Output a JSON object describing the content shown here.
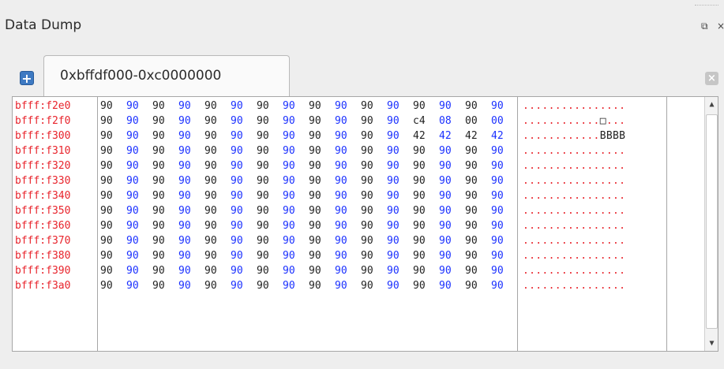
{
  "window": {
    "title": "Data Dump"
  },
  "tab": {
    "label": "0xbffdf000-0xc0000000"
  },
  "colors": {
    "address": "#e8232b",
    "byte_blue": "#1a30ff",
    "byte_black": "#222222",
    "ascii": "#e8232b"
  },
  "rows": [
    {
      "addr": "bfff:f2e0",
      "bytes": [
        "90",
        "90",
        "90",
        "90",
        "90",
        "90",
        "90",
        "90",
        "90",
        "90",
        "90",
        "90",
        "90",
        "90",
        "90",
        "90"
      ],
      "ascii": "................"
    },
    {
      "addr": "bfff:f2f0",
      "bytes": [
        "90",
        "90",
        "90",
        "90",
        "90",
        "90",
        "90",
        "90",
        "90",
        "90",
        "90",
        "90",
        "c4",
        "08",
        "00",
        "00"
      ],
      "ascii": "............□..."
    },
    {
      "addr": "bfff:f300",
      "bytes": [
        "90",
        "90",
        "90",
        "90",
        "90",
        "90",
        "90",
        "90",
        "90",
        "90",
        "90",
        "90",
        "42",
        "42",
        "42",
        "42"
      ],
      "ascii": "............BBBB"
    },
    {
      "addr": "bfff:f310",
      "bytes": [
        "90",
        "90",
        "90",
        "90",
        "90",
        "90",
        "90",
        "90",
        "90",
        "90",
        "90",
        "90",
        "90",
        "90",
        "90",
        "90"
      ],
      "ascii": "................"
    },
    {
      "addr": "bfff:f320",
      "bytes": [
        "90",
        "90",
        "90",
        "90",
        "90",
        "90",
        "90",
        "90",
        "90",
        "90",
        "90",
        "90",
        "90",
        "90",
        "90",
        "90"
      ],
      "ascii": "................"
    },
    {
      "addr": "bfff:f330",
      "bytes": [
        "90",
        "90",
        "90",
        "90",
        "90",
        "90",
        "90",
        "90",
        "90",
        "90",
        "90",
        "90",
        "90",
        "90",
        "90",
        "90"
      ],
      "ascii": "................"
    },
    {
      "addr": "bfff:f340",
      "bytes": [
        "90",
        "90",
        "90",
        "90",
        "90",
        "90",
        "90",
        "90",
        "90",
        "90",
        "90",
        "90",
        "90",
        "90",
        "90",
        "90"
      ],
      "ascii": "................"
    },
    {
      "addr": "bfff:f350",
      "bytes": [
        "90",
        "90",
        "90",
        "90",
        "90",
        "90",
        "90",
        "90",
        "90",
        "90",
        "90",
        "90",
        "90",
        "90",
        "90",
        "90"
      ],
      "ascii": "................"
    },
    {
      "addr": "bfff:f360",
      "bytes": [
        "90",
        "90",
        "90",
        "90",
        "90",
        "90",
        "90",
        "90",
        "90",
        "90",
        "90",
        "90",
        "90",
        "90",
        "90",
        "90"
      ],
      "ascii": "................"
    },
    {
      "addr": "bfff:f370",
      "bytes": [
        "90",
        "90",
        "90",
        "90",
        "90",
        "90",
        "90",
        "90",
        "90",
        "90",
        "90",
        "90",
        "90",
        "90",
        "90",
        "90"
      ],
      "ascii": "................"
    },
    {
      "addr": "bfff:f380",
      "bytes": [
        "90",
        "90",
        "90",
        "90",
        "90",
        "90",
        "90",
        "90",
        "90",
        "90",
        "90",
        "90",
        "90",
        "90",
        "90",
        "90"
      ],
      "ascii": "................"
    },
    {
      "addr": "bfff:f390",
      "bytes": [
        "90",
        "90",
        "90",
        "90",
        "90",
        "90",
        "90",
        "90",
        "90",
        "90",
        "90",
        "90",
        "90",
        "90",
        "90",
        "90"
      ],
      "ascii": "................"
    },
    {
      "addr": "bfff:f3a0",
      "bytes": [
        "90",
        "90",
        "90",
        "90",
        "90",
        "90",
        "90",
        "90",
        "90",
        "90",
        "90",
        "90",
        "90",
        "90",
        "90",
        "90"
      ],
      "ascii": "................"
    }
  ],
  "icons": {
    "float": "float-window-icon",
    "close_panel": "close-panel-icon",
    "add_tab": "add-tab-icon",
    "close_tab": "close-tab-icon",
    "scroll_up": "scroll-up-arrow-icon",
    "scroll_down": "scroll-down-arrow-icon"
  },
  "glyphs": {
    "add": "+",
    "close": "×",
    "float": "⧉",
    "up": "▲",
    "down": "▼"
  }
}
